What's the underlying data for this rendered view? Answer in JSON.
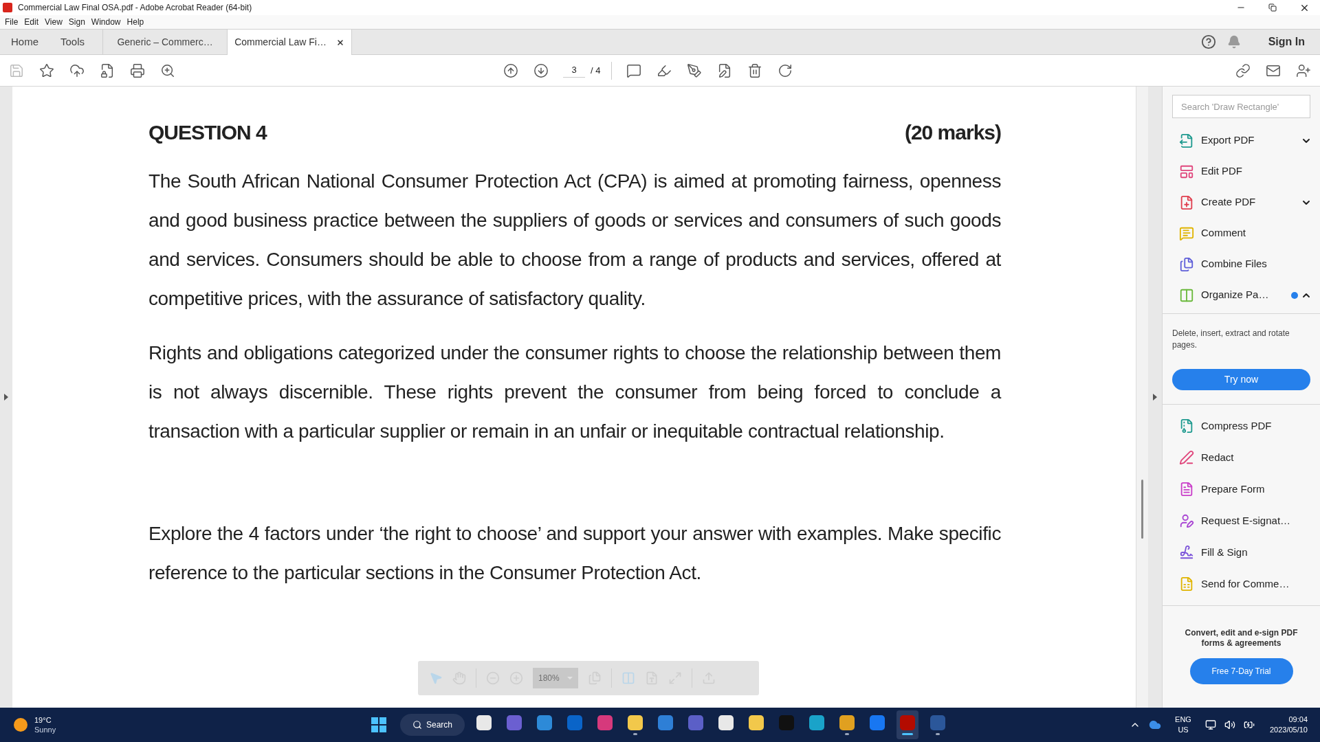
{
  "window": {
    "title": "Commercial Law Final OSA.pdf - Adobe Acrobat Reader (64-bit)"
  },
  "menu": [
    "File",
    "Edit",
    "View",
    "Sign",
    "Window",
    "Help"
  ],
  "nav": [
    "Home",
    "Tools"
  ],
  "doc_tabs": [
    {
      "label": "Generic – Commerc…",
      "selected": false
    },
    {
      "label": "Commercial Law Fi…",
      "selected": true
    }
  ],
  "header": {
    "sign_in": "Sign In"
  },
  "toolbar": {
    "page_current": "3",
    "page_total": "/ 4"
  },
  "document": {
    "heading": "QUESTION 4",
    "marks": "(20 marks)",
    "paragraphs": [
      "The South African National Consumer Protection Act (CPA) is aimed at promoting fairness, openness and good business practice between the suppliers of goods or services and consumers of such goods and services.  Consumers should be able to choose from a range of products and services, offered at competitive prices, with the assurance of satisfactory quality.",
      "Rights and obligations categorized under the consumer rights to choose the relationship between them is not always discernible. These rights prevent the consumer from being forced to conclude a transaction with a particular supplier or remain in an unfair or inequitable contractual relationship.",
      "Explore the 4 factors under ‘the right to choose’ and support your answer with examples. Make specific reference to the particular sections in the Consumer Protection Act."
    ]
  },
  "floating_toolbar": {
    "zoom": "180%"
  },
  "right_panel": {
    "search": {
      "placeholder": "Search 'Draw Rectangle'"
    },
    "tools_top": [
      {
        "label": "Export PDF",
        "kind": "dropdown",
        "expanded": false
      },
      {
        "label": "Edit PDF",
        "kind": "link"
      },
      {
        "label": "Create PDF",
        "kind": "dropdown",
        "expanded": false
      },
      {
        "label": "Comment",
        "kind": "link"
      },
      {
        "label": "Combine Files",
        "kind": "link"
      },
      {
        "label": "Organize Pa…",
        "kind": "dropdown",
        "expanded": true
      }
    ],
    "organize_description": "Delete, insert, extract and rotate pages.",
    "try_button": "Try now",
    "tools_bottom": [
      "Compress PDF",
      "Redact",
      "Prepare Form",
      "Request E-signat…",
      "Fill & Sign",
      "Send for Comme…"
    ],
    "promo": "Convert, edit and e-sign PDF forms & agreements",
    "trial_button": "Free 7-Day Trial"
  },
  "taskbar": {
    "temperature": "19°C",
    "condition": "Sunny",
    "search": "Search",
    "apps": [
      {
        "running": false,
        "selected": false
      },
      {
        "running": false,
        "selected": false
      },
      {
        "running": false,
        "selected": false
      },
      {
        "running": false,
        "selected": false
      },
      {
        "running": false,
        "selected": false
      },
      {
        "running": true,
        "selected": false
      },
      {
        "running": false,
        "selected": false
      },
      {
        "running": false,
        "selected": false
      },
      {
        "running": false,
        "selected": false
      },
      {
        "running": false,
        "selected": false
      },
      {
        "running": false,
        "selected": false
      },
      {
        "running": false,
        "selected": false
      },
      {
        "running": true,
        "selected": false
      },
      {
        "running": false,
        "selected": false
      },
      {
        "running": true,
        "selected": true
      },
      {
        "running": true,
        "selected": false
      }
    ],
    "language": "ENG",
    "region": "US",
    "time": "09:04",
    "date": "2023/05/10"
  }
}
